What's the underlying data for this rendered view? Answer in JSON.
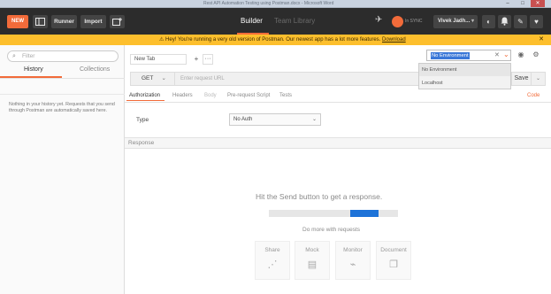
{
  "window": {
    "title": "Rest API Automation Testing using Postman.docx - Microsoft Word",
    "minimize": "–",
    "maximize": "□",
    "close": "✕"
  },
  "header": {
    "new_label": "NEW",
    "runner_label": "Runner",
    "import_label": "Import",
    "tab_builder": "Builder",
    "tab_team_library": "Team Library",
    "sync_status": "In SYNC",
    "user_label": "Vivek Jadh..."
  },
  "banner": {
    "message": "Hey! You're running a very old version of Postman. Our newest app has a lot more features.",
    "link_text": "Download",
    "close": "✕"
  },
  "sidebar": {
    "search_placeholder": "Filter",
    "tabs": [
      "History",
      "Collections"
    ],
    "empty_text": "Nothing in your history yet. Requests that you send through Postman are automatically saved here."
  },
  "request": {
    "tab_label": "New Tab",
    "tab_add": "+",
    "tab_more": "···",
    "method": "GET",
    "url_placeholder": "Enter request URL",
    "save_label": "Save",
    "sub_tabs": [
      "Authorization",
      "Headers",
      "Body",
      "Pre-request Script",
      "Tests"
    ],
    "code_link": "Code",
    "auth_type_label": "Type",
    "auth_type_value": "No Auth"
  },
  "environment": {
    "selected": "No Environment",
    "options": [
      "No Environment",
      "Localhost"
    ]
  },
  "response": {
    "header": "Response",
    "hint": "Hit the Send button to get a response.",
    "progress_fraction": 0.22,
    "progress_offset_fraction": 0.63,
    "do_more": "Do more with requests",
    "cards": [
      {
        "label": "Share",
        "icon": "share-icon"
      },
      {
        "label": "Mock",
        "icon": "mock-icon"
      },
      {
        "label": "Monitor",
        "icon": "monitor-icon"
      },
      {
        "label": "Document",
        "icon": "document-icon"
      }
    ]
  },
  "colors": {
    "accent": "#f26b3a",
    "header_bg": "#2c2c2c",
    "banner_bg": "#fdbf2d",
    "progress_fill": "#1e73d8",
    "selection": "#3b78d8"
  }
}
